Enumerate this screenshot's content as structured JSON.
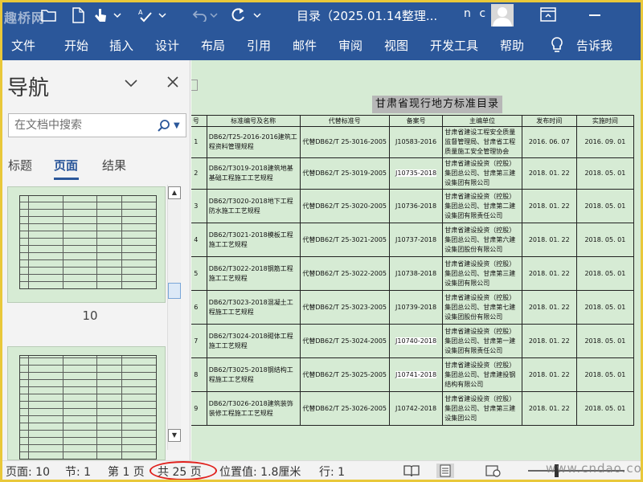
{
  "window": {
    "watermark": "趣桥网",
    "title": "目录（2025.01.14整理...",
    "user": "n c"
  },
  "menu": [
    "文件",
    "开始",
    "插入",
    "设计",
    "布局",
    "引用",
    "邮件",
    "审阅",
    "视图",
    "开发工具",
    "帮助",
    "告诉我"
  ],
  "nav": {
    "title": "导航",
    "search_placeholder": "在文档中搜索",
    "tabs": [
      "标题",
      "页面",
      "结果"
    ],
    "active_tab": "页面",
    "page_thumb_label": "10"
  },
  "document": {
    "heading": "甘肃省现行地方标准目录",
    "table": {
      "headers": [
        "号",
        "标准编号及名称",
        "代替标准号",
        "备案号",
        "主编单位",
        "发布时间",
        "实施时间"
      ],
      "rows": [
        {
          "no": "1",
          "name": "DB62/T25-2016-2016建筑工程资料管理规程",
          "replace": "代替DB62/T 25-3016-2005",
          "record": "J10583-2016",
          "editor": "甘肃省建设工程安全质量监督管理局、甘肃省工程质量施工安全管理协会",
          "publish": "2016. 06. 07",
          "effective": "2016. 09. 01"
        },
        {
          "no": "2",
          "name": "DB62/T3019-2018建筑地基基础工程施工工艺规程",
          "replace": "代替DB62/T 25-3019-2005",
          "record": "J10735-2018",
          "editor": "甘肃省建设投资（控股）集团总公司、甘肃第三建设集团有限公司",
          "publish": "2018. 01. 22",
          "effective": "2018. 05. 01"
        },
        {
          "no": "3",
          "name": "DB62/T3020-2018地下工程防水施工工艺规程",
          "replace": "代替DB62/T 25-3020-2005",
          "record": "J10736-2018",
          "editor": "甘肃省建设投资（控股）集团总公司、甘肃第二建设集团有限责任公司",
          "publish": "2018. 01. 22",
          "effective": "2018. 05. 01"
        },
        {
          "no": "4",
          "name": "DB62/T3021-2018模板工程施工工艺规程",
          "replace": "代替DB62/T 25-3021-2005",
          "record": "J10737-2018",
          "editor": "甘肃省建设投资（控股）集团总公司、甘肃第六建设集团股份有限公司",
          "publish": "2018. 01. 22",
          "effective": "2018. 05. 01"
        },
        {
          "no": "5",
          "name": "DB62/T3022-2018钢筋工程施工工艺规程",
          "replace": "代替DB62/T 25-3022-2005",
          "record": "J10738-2018",
          "editor": "甘肃省建设投资（控股）集团总公司、甘肃第三建设集团有限公司",
          "publish": "2018. 01. 22",
          "effective": "2018. 05. 01"
        },
        {
          "no": "6",
          "name": "DB62/T3023-2018混凝土工程施工工艺规程",
          "replace": "代替DB62/T 25-3023-2005",
          "record": "J10739-2018",
          "editor": "甘肃省建设投资（控股）集团总公司、甘肃第七建设集团股份有限公司",
          "publish": "2018. 01. 22",
          "effective": "2018. 05. 01"
        },
        {
          "no": "7",
          "name": "DB62/T3024-2018砌体工程施工工艺规程",
          "replace": "代替DB62/T 25-3024-2005",
          "record": "J10740-2018",
          "editor": "甘肃省建设投资（控股）集团总公司、甘肃第一建设集团有限责任公司",
          "publish": "2018. 01. 22",
          "effective": "2018. 05. 01"
        },
        {
          "no": "8",
          "name": "DB62/T3025-2018钢结构工程施工工艺规程",
          "replace": "代替DB62/T 25-3025-2005",
          "record": "J10741-2018",
          "editor": "甘肃省建设投资（控股）集团总公司、甘肃建投钢结构有限公司",
          "publish": "2018. 01. 22",
          "effective": "2018. 05. 01"
        },
        {
          "no": "9",
          "name": "DB62/T3026-2018建筑装饰装修工程施工工艺规程",
          "replace": "代替DB62/T 25-3026-2005",
          "record": "J10742-2018",
          "editor": "甘肃省建设投资（控股）集团总公司、甘肃第三建设集团公司",
          "publish": "2018. 01. 22",
          "effective": "2018. 05. 01"
        }
      ]
    }
  },
  "status": {
    "page": "页面: 10",
    "section": "节: 1",
    "page_of": "第 1 页",
    "total_pages": "共 25 页",
    "position": "位置值: 1.8厘米",
    "line": "行: 1",
    "site_watermark": "www.cndao.com"
  },
  "colors": {
    "ribbon": "#2b579a",
    "page_background": "#d6ebd4",
    "highlight_circle": "#e0211d",
    "outer_border": "#e9c83a"
  }
}
